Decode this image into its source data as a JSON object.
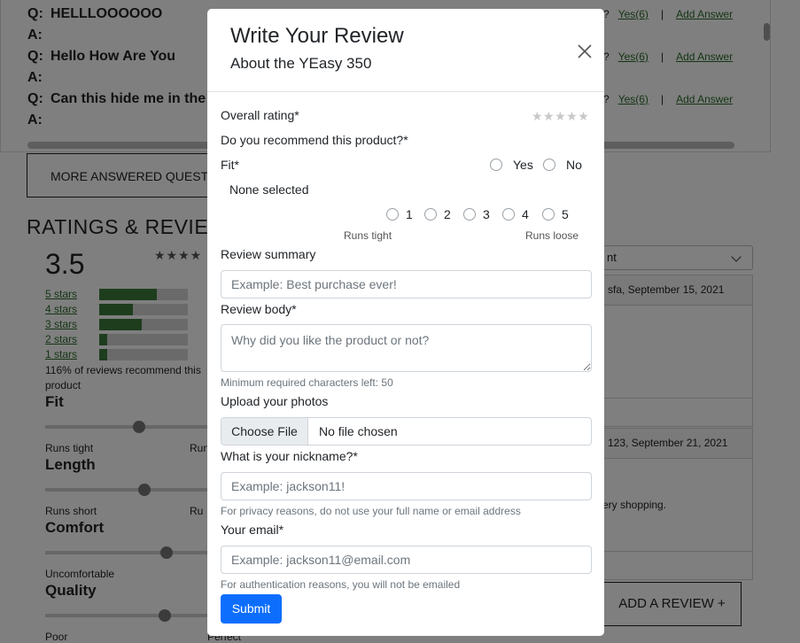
{
  "background": {
    "qa": [
      {
        "q_prefix": "Q:",
        "question": "HELLLOOOOOO",
        "a_prefix": "A:",
        "helpful_q": "?",
        "yes": "Yes(6)",
        "sep": "|",
        "add_answer": "Add Answer"
      },
      {
        "q_prefix": "Q:",
        "question": "Hello How Are You",
        "a_prefix": "A:",
        "helpful_q": "?",
        "yes": "Yes(6)",
        "sep": "|",
        "add_answer": "Add Answer"
      },
      {
        "q_prefix": "Q:",
        "question": "Can this hide me in the",
        "a_prefix": "A:",
        "helpful_q": "?",
        "yes": "Yes(6)",
        "sep": "|",
        "add_answer": "Add Answer"
      }
    ],
    "more_questions": "MORE ANSWERED QUESTI",
    "ratings_title": "RATINGS & REVIEW",
    "average": "3.5",
    "average_stars": "★★★★",
    "star_bars": [
      {
        "label": "5 stars",
        "fraction": 0.65
      },
      {
        "label": "4 stars",
        "fraction": 0.38
      },
      {
        "label": "3 stars",
        "fraction": 0.48
      },
      {
        "label": "2 stars",
        "fraction": 0.09
      },
      {
        "label": "1 stars",
        "fraction": 0.09
      }
    ],
    "recommend_text": "116% of reviews recommend this product",
    "characteristics": [
      {
        "name": "Fit",
        "left_label": "Runs tight",
        "right_label": "Run",
        "value": 0.56
      },
      {
        "name": "Length",
        "left_label": "Runs short",
        "right_label": "Ru",
        "value": 0.59
      },
      {
        "name": "Comfort",
        "left_label": "Uncomfortable",
        "right_label": "",
        "value": 0.72
      },
      {
        "name": "Quality",
        "left_label": "Poor",
        "right_label": "Perfect",
        "value": 0.71
      }
    ],
    "sort_value": "nt",
    "reviews": [
      {
        "header": "sfa, September 15, 2021",
        "body": ""
      },
      {
        "header": "123, September 21, 2021",
        "body": "ery shopping."
      }
    ],
    "add_review": "ADD A REVIEW +"
  },
  "modal": {
    "title": "Write Your Review",
    "subtitle": "About the YEasy 350",
    "overall_label": "Overall rating*",
    "rating_stars": "★★★★★",
    "recommend_label": "Do you recommend this product?*",
    "fit_label": "Fit*",
    "yes_label": "Yes",
    "no_label": "No",
    "none_selected": "None selected",
    "scale": [
      "1",
      "2",
      "3",
      "4",
      "5"
    ],
    "scale_low": "Runs tight",
    "scale_high": "Runs loose",
    "summary_label": "Review summary",
    "summary_placeholder": "Example: Best purchase ever!",
    "body_label": "Review body*",
    "body_placeholder": "Why did you like the product or not?",
    "body_helper": "Minimum required characters left: 50",
    "photos_label": "Upload your photos",
    "choose_file": "Choose File",
    "no_file": "No file chosen",
    "nickname_label": "What is your nickname?*",
    "nickname_placeholder": "Example: jackson11!",
    "nickname_helper": "For privacy reasons, do not use your full name or email address",
    "email_label": "Your email*",
    "email_placeholder": "Example: jackson11@email.com",
    "email_helper": "For authentication reasons, you will not be emailed",
    "submit": "Submit"
  }
}
